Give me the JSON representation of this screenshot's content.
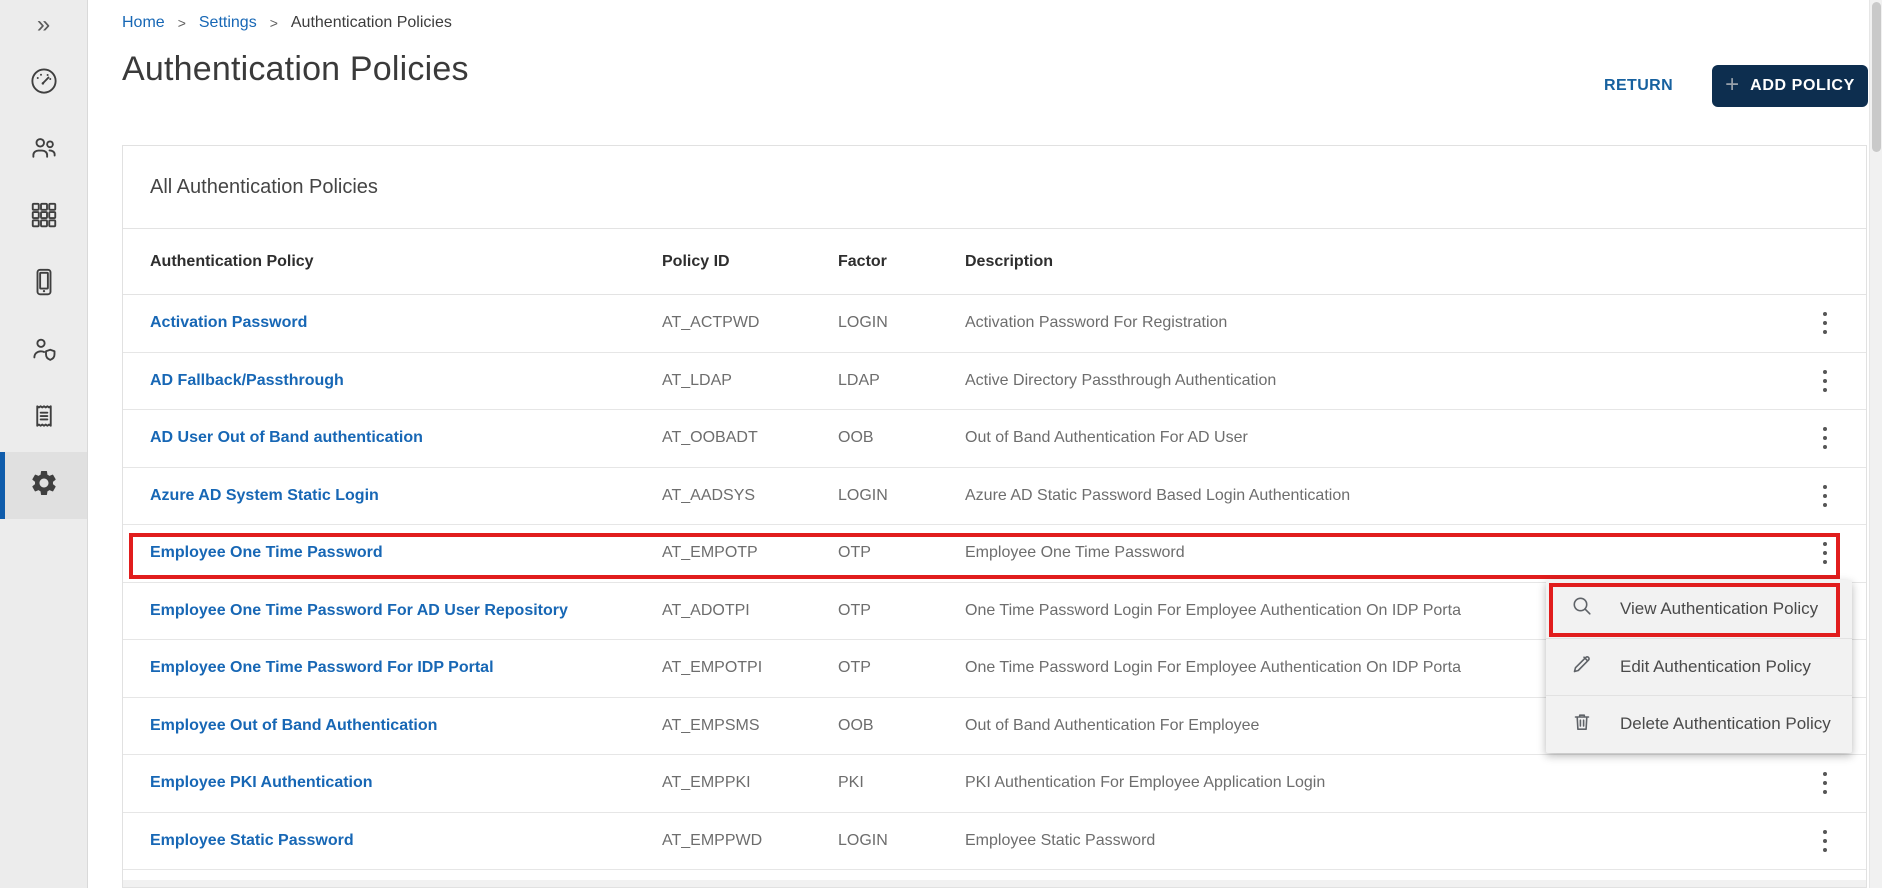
{
  "breadcrumb": {
    "separator": ">",
    "items": [
      {
        "label": "Home"
      },
      {
        "label": "Settings"
      },
      {
        "label": "Authentication Policies"
      }
    ]
  },
  "page": {
    "title": "Authentication Policies"
  },
  "toolbar": {
    "return_label": "RETURN",
    "add_policy_label": "ADD POLICY",
    "plus_glyph": "+"
  },
  "sidebar": {
    "collapse_glyph": "»",
    "items": [
      {
        "name": "dashboard",
        "icon": "dashboard",
        "active": false
      },
      {
        "name": "users",
        "icon": "users",
        "active": false
      },
      {
        "name": "applications",
        "icon": "grid",
        "active": false
      },
      {
        "name": "devices",
        "icon": "mobile",
        "active": false
      },
      {
        "name": "user-security",
        "icon": "user-shield",
        "active": false
      },
      {
        "name": "reports",
        "icon": "report",
        "active": false
      },
      {
        "name": "settings",
        "icon": "gear",
        "active": true
      }
    ]
  },
  "card": {
    "title": "All Authentication Policies"
  },
  "table": {
    "headers": [
      "Authentication Policy",
      "Policy ID",
      "Factor",
      "Description"
    ],
    "rows": [
      {
        "policy": "Activation Password",
        "policy_id": "AT_ACTPWD",
        "factor": "LOGIN",
        "description": "Activation Password For Registration",
        "highlighted": false
      },
      {
        "policy": "AD Fallback/Passthrough",
        "policy_id": "AT_LDAP",
        "factor": "LDAP",
        "description": "Active Directory Passthrough Authentication",
        "highlighted": false
      },
      {
        "policy": "AD User Out of Band authentication",
        "policy_id": "AT_OOBADT",
        "factor": "OOB",
        "description": "Out of Band Authentication For AD User",
        "highlighted": false
      },
      {
        "policy": "Azure AD System Static Login",
        "policy_id": "AT_AADSYS",
        "factor": "LOGIN",
        "description": "Azure AD Static Password Based Login Authentication",
        "highlighted": false
      },
      {
        "policy": "Employee One Time Password",
        "policy_id": "AT_EMPOTP",
        "factor": "OTP",
        "description": "Employee One Time Password",
        "highlighted": true
      },
      {
        "policy": "Employee One Time Password For AD User Repository",
        "policy_id": "AT_ADOTPI",
        "factor": "OTP",
        "description": "One Time Password Login For Employee Authentication On IDP Porta",
        "highlighted": false
      },
      {
        "policy": "Employee One Time Password For IDP Portal",
        "policy_id": "AT_EMPOTPI",
        "factor": "OTP",
        "description": "One Time Password Login For Employee Authentication On IDP Porta",
        "highlighted": false
      },
      {
        "policy": "Employee Out of Band Authentication",
        "policy_id": "AT_EMPSMS",
        "factor": "OOB",
        "description": "Out of Band Authentication For Employee",
        "highlighted": false
      },
      {
        "policy": "Employee PKI Authentication",
        "policy_id": "AT_EMPPKI",
        "factor": "PKI",
        "description": "PKI Authentication For Employee Application Login",
        "highlighted": false
      },
      {
        "policy": "Employee Static Password",
        "policy_id": "AT_EMPPWD",
        "factor": "LOGIN",
        "description": "Employee Static Password",
        "highlighted": false
      }
    ]
  },
  "context_menu": {
    "items": [
      {
        "icon": "search",
        "label": "View Authentication Policy",
        "highlighted": true
      },
      {
        "icon": "pencil",
        "label": "Edit Authentication Policy",
        "highlighted": false
      },
      {
        "icon": "trash",
        "label": "Delete Authentication Policy",
        "highlighted": false
      }
    ]
  },
  "colors": {
    "accent_blue": "#1767b5",
    "button_navy": "#0d2e4f",
    "highlight_red": "#e11d1d",
    "sidebar_active_bar": "#0f5cab"
  }
}
